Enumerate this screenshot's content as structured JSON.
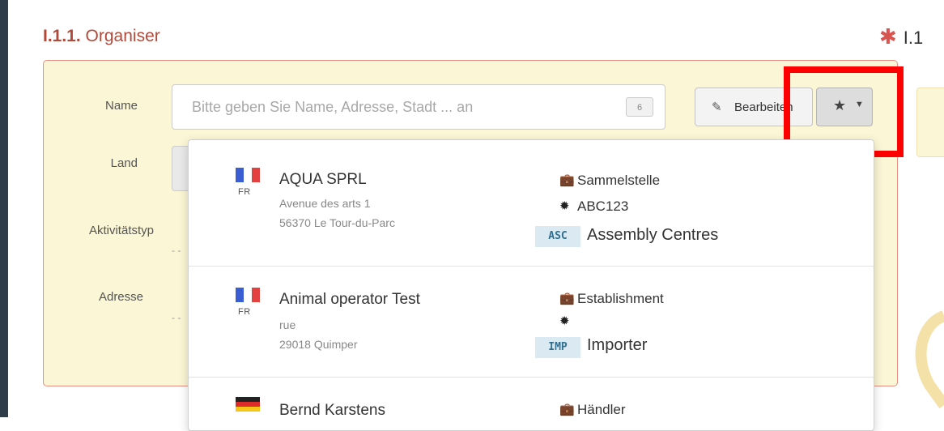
{
  "section": {
    "number": "I.1.1.",
    "title": "Organiser"
  },
  "next_section": {
    "marker": "✱",
    "number": "I.1"
  },
  "form": {
    "labels": {
      "name": "Name",
      "land": "Land",
      "activity": "Aktivitätstyp",
      "address": "Adresse"
    },
    "name_placeholder": "Bitte geben Sie Name, Adresse, Stadt ... an",
    "name_badge": "6",
    "edit_button": "Bearbeiten",
    "dashes": "- -"
  },
  "results": [
    {
      "flag": "fr",
      "country": "FR",
      "name": "AQUA SPRL",
      "street": "Avenue des arts 1",
      "city": "56370 Le Tour-du-Parc",
      "type": "Sammelstelle",
      "approval": "ABC123",
      "code": "ASC",
      "code_label": "Assembly Centres"
    },
    {
      "flag": "fr",
      "country": "FR",
      "name": "Animal operator Test",
      "street": "rue",
      "city": "29018 Quimper",
      "type": "Establishment",
      "approval": "",
      "code": "IMP",
      "code_label": "Importer"
    },
    {
      "flag": "de",
      "country": "",
      "name": "Bernd Karstens",
      "type": "Händler"
    }
  ],
  "colors": {
    "section_title": "#b24a3a",
    "panel_bg": "#fbf6d5",
    "highlight_box": "#ff0000",
    "code_bg": "#dbe9f3"
  },
  "icons": [
    "edit-icon",
    "star-icon",
    "caret-down-icon",
    "briefcase-icon",
    "badge-icon"
  ]
}
